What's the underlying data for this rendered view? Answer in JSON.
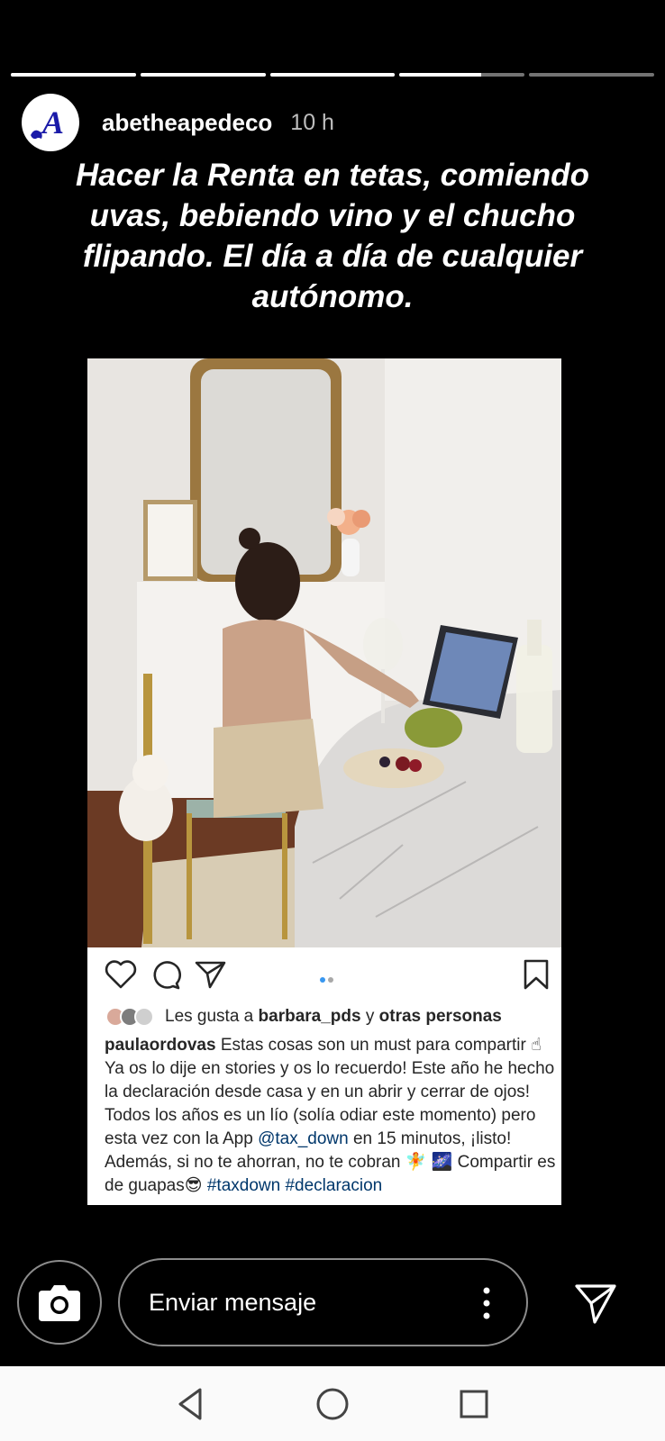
{
  "progress": [
    1,
    1,
    1,
    0.65,
    0
  ],
  "header": {
    "username": "abetheapedeco",
    "time": "10 h",
    "avatar_letter": "A",
    "avatar_color": "#1a1aa8"
  },
  "story_text": "Hacer la Renta en tetas, comiendo uvas, bebiendo vino y el chucho flipando. El día a día de cualquier autónomo.",
  "post": {
    "likes_prefix": "Les gusta a",
    "likes_user": "barbara_pds",
    "likes_mid": "y",
    "likes_others": "otras personas",
    "caption_user": "paulaordovas",
    "caption_part1": "Estas cosas son un must para compartir ☝ Ya os lo dije en stories y os lo recuerdo! Este año he hecho la declaración desde casa y en un abrir y cerrar de ojos! Todos los años es un lío (solía odiar este momento) pero esta vez con la App",
    "caption_mention": "@tax_down",
    "caption_part2": "en 15 minutos, ¡listo! Además, si no te ahorran, no te cobran 🧚 🌌 Compartir es de guapas😎",
    "hashtag1": "#taxdown",
    "hashtag2": "#declaracion",
    "carousel_count": 2,
    "carousel_active": 1,
    "accent": "#3897f0"
  },
  "bottom": {
    "message_placeholder": "Enviar mensaje"
  },
  "icons": [
    "camera-icon",
    "more-vert-icon",
    "send-icon",
    "heart-icon",
    "comment-icon",
    "share-icon",
    "bookmark-icon",
    "nav-back-icon",
    "nav-home-icon",
    "nav-recents-icon"
  ]
}
